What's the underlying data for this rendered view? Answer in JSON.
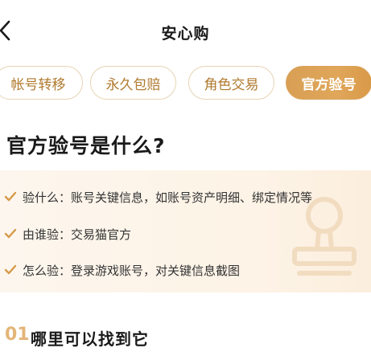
{
  "header": {
    "title": "安心购"
  },
  "tabs": [
    {
      "label": "帐号转移",
      "active": false
    },
    {
      "label": "永久包赔",
      "active": false
    },
    {
      "label": "角色交易",
      "active": false
    },
    {
      "label": "官方验号",
      "active": true
    }
  ],
  "section": {
    "title": "官方验号是什么?"
  },
  "info": {
    "items": [
      {
        "text": "验什么：账号关键信息，如账号资产明细、绑定情况等"
      },
      {
        "text": "由谁验：交易猫官方"
      },
      {
        "text": "怎么验：登录游戏账号，对关键信息截图"
      }
    ]
  },
  "section01": {
    "number": "01",
    "title": "哪里可以找到它"
  },
  "colors": {
    "accent": "#dba35a",
    "tab_text": "#b07a2e",
    "tab_border": "#e6d4b5",
    "card_bg": "#fdf5ea",
    "number_color": "#e3b577"
  }
}
